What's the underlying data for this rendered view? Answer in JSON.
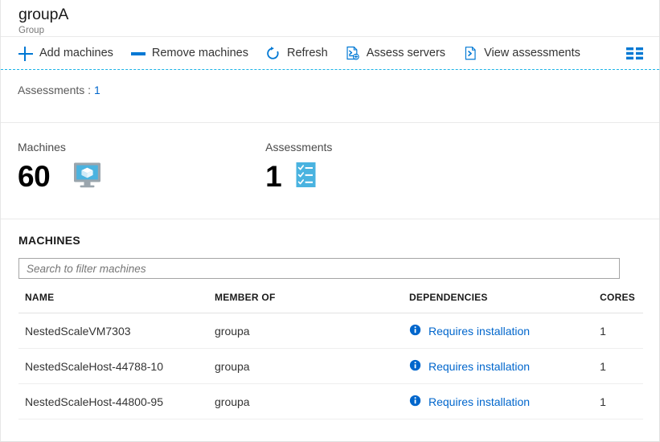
{
  "header": {
    "title": "groupA",
    "subtitle": "Group"
  },
  "toolbar": {
    "items": [
      {
        "label": "Add machines",
        "icon": "plus-icon"
      },
      {
        "label": "Remove machines",
        "icon": "minus-icon"
      },
      {
        "label": "Refresh",
        "icon": "refresh-icon"
      },
      {
        "label": "Assess servers",
        "icon": "assess-servers-icon"
      },
      {
        "label": "View assessments",
        "icon": "view-assessments-icon"
      }
    ],
    "grid_icon": "column-options-icon"
  },
  "filter": {
    "label": "Assessments  :",
    "value": "1"
  },
  "stats": [
    {
      "label": "Machines",
      "value": "60",
      "icon": "monitor-box-icon"
    },
    {
      "label": "Assessments",
      "value": "1",
      "icon": "checklist-icon"
    }
  ],
  "machines_section": {
    "title": "MACHINES",
    "search_placeholder": "Search to filter machines",
    "search_value": "",
    "columns": [
      "NAME",
      "MEMBER OF",
      "DEPENDENCIES",
      "CORES"
    ],
    "rows": [
      {
        "name": "NestedScaleVM7303",
        "member_of": "groupa",
        "dependencies": "Requires installation",
        "dependencies_icon": "info-icon",
        "cores": "1"
      },
      {
        "name": "NestedScaleHost-44788-10",
        "member_of": "groupa",
        "dependencies": "Requires installation",
        "dependencies_icon": "info-icon",
        "cores": "1"
      },
      {
        "name": "NestedScaleHost-44800-95",
        "member_of": "groupa",
        "dependencies": "Requires installation",
        "dependencies_icon": "info-icon",
        "cores": "1"
      }
    ]
  },
  "colors": {
    "accent_blue": "#0078d4",
    "link_blue": "#0066cc",
    "dashed_rule": "#1bb3e6",
    "icon_fill": "#4ab3e0"
  }
}
